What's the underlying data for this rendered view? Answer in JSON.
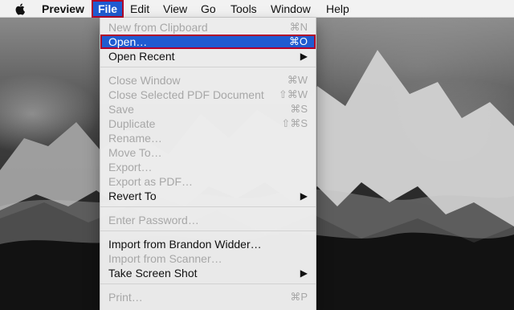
{
  "menubar": {
    "apple": "apple-icon",
    "items": [
      {
        "label": "Preview"
      },
      {
        "label": "File"
      },
      {
        "label": "Edit"
      },
      {
        "label": "View"
      },
      {
        "label": "Go"
      },
      {
        "label": "Tools"
      },
      {
        "label": "Window"
      },
      {
        "label": "Help"
      }
    ]
  },
  "file_menu": {
    "items": [
      {
        "label": "New from Clipboard",
        "shortcut": "⌘N",
        "disabled": true
      },
      {
        "label": "Open…",
        "shortcut": "⌘O",
        "selected": true
      },
      {
        "label": "Open Recent",
        "submenu": true
      },
      {
        "label": "Close Window",
        "shortcut": "⌘W",
        "disabled": true
      },
      {
        "label": "Close Selected PDF Document",
        "shortcut": "⇧⌘W",
        "disabled": true
      },
      {
        "label": "Save",
        "shortcut": "⌘S",
        "disabled": true
      },
      {
        "label": "Duplicate",
        "shortcut": "⇧⌘S",
        "disabled": true
      },
      {
        "label": "Rename…",
        "disabled": true
      },
      {
        "label": "Move To…",
        "disabled": true
      },
      {
        "label": "Export…",
        "disabled": true
      },
      {
        "label": "Export as PDF…",
        "disabled": true
      },
      {
        "label": "Revert To",
        "submenu": true
      },
      {
        "label": "Enter Password…",
        "disabled": true
      },
      {
        "label": "Import from Brandon Widder…"
      },
      {
        "label": "Import from Scanner…",
        "disabled": true
      },
      {
        "label": "Take Screen Shot",
        "submenu": true
      },
      {
        "label": "Print…",
        "shortcut": "⌘P",
        "disabled": true
      }
    ]
  }
}
